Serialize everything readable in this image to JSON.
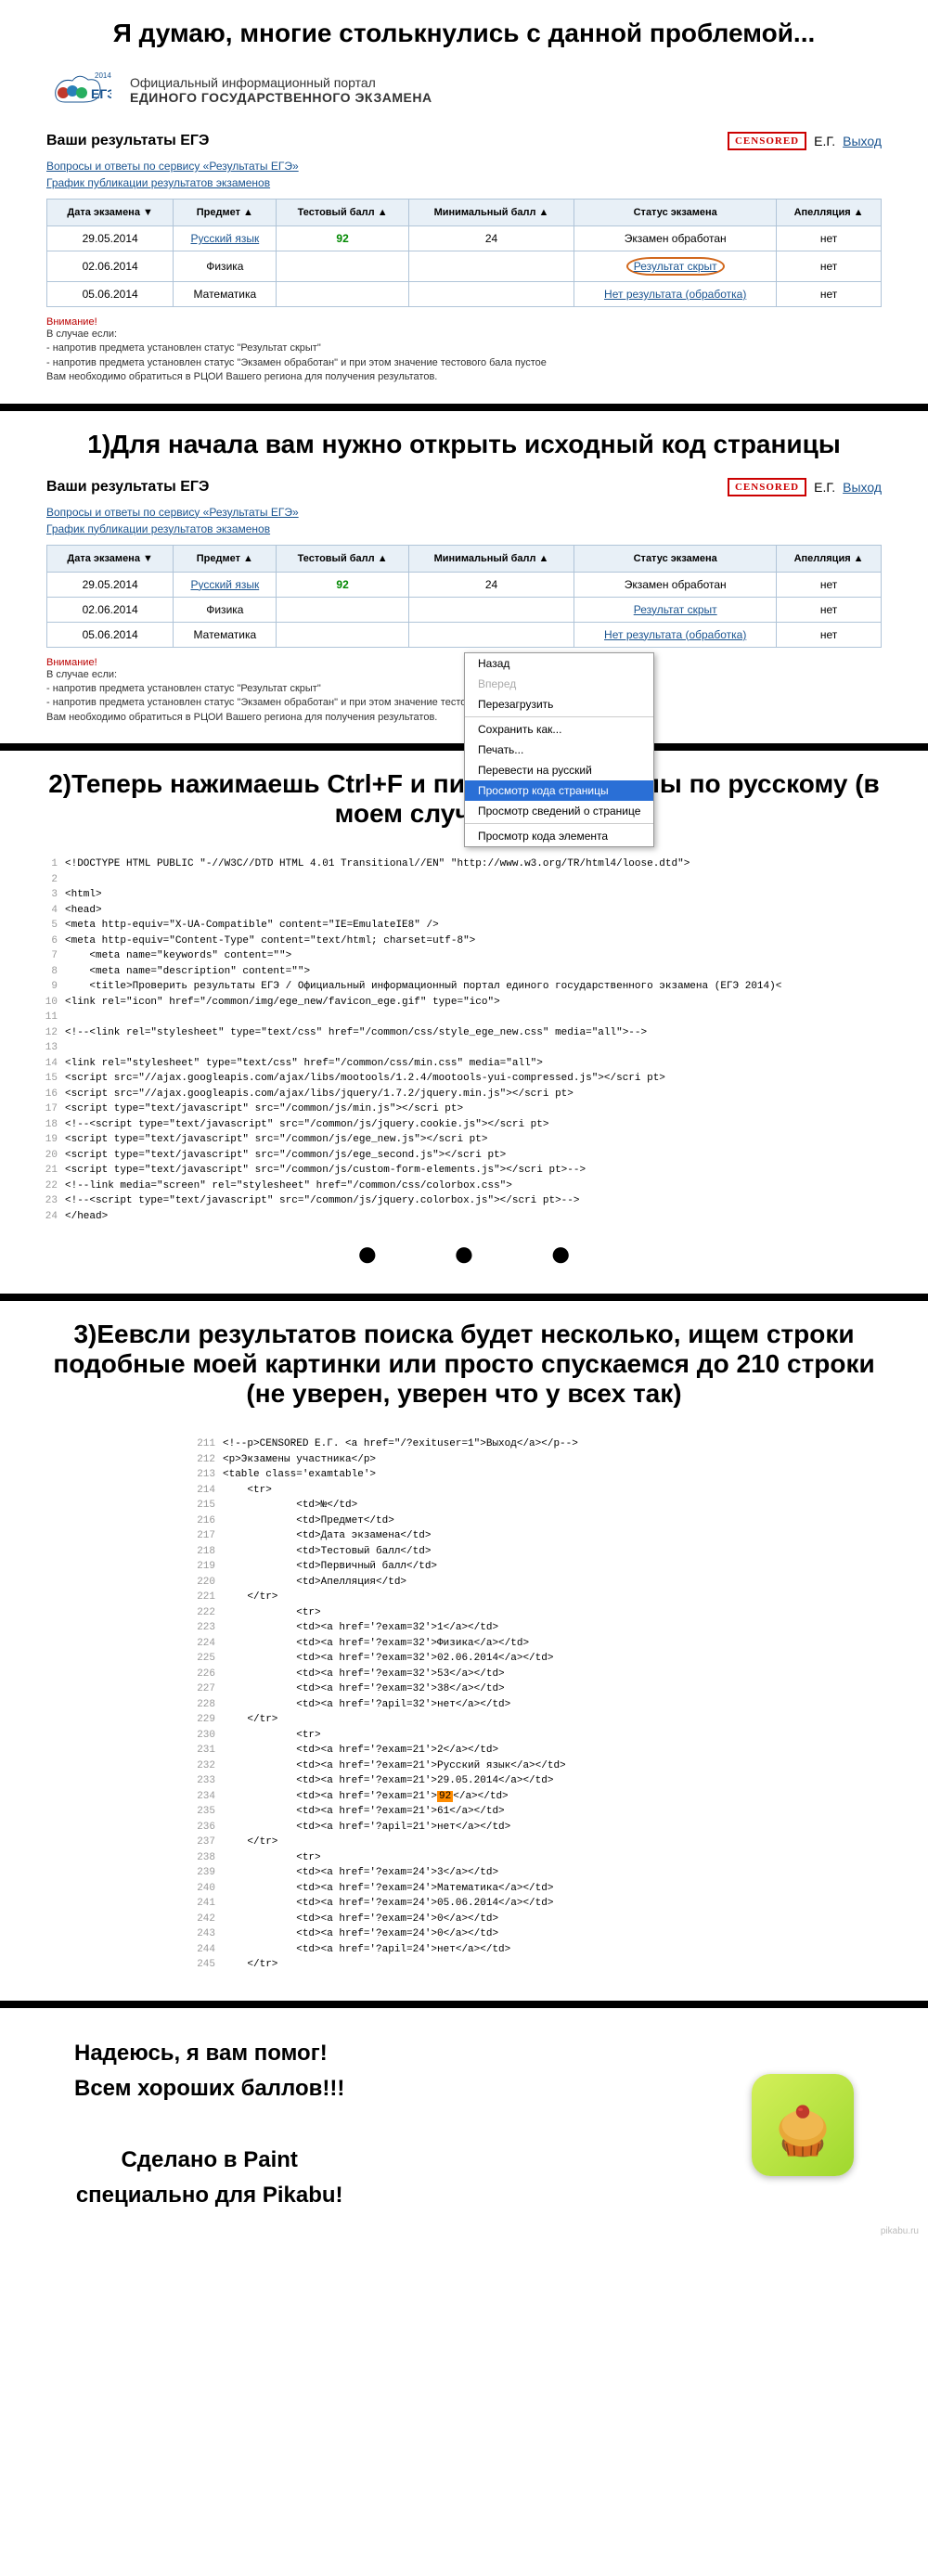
{
  "intro_title": "Я думаю, многие столькнулись с данной проблемой...",
  "portal": {
    "year": "2014",
    "logo_text": "ЕГЭ",
    "line1": "Официальный информационный портал",
    "line2": "ЕДИНОГО ГОСУДАРСТВЕННОГО ЭКЗАМЕНА"
  },
  "results_header": "Ваши результаты ЕГЭ",
  "censored": "CENSORED",
  "user_initials": "Е.Г.",
  "logout": "Выход",
  "qa_link": "Вопросы и ответы по сервису «Результаты ЕГЭ»",
  "schedule_link": "График публикации результатов экзаменов",
  "table_headers": {
    "date": "Дата экзамена ▼",
    "subject": "Предмет ▲",
    "test_score": "Тестовый балл ▲",
    "min_score": "Минимальный балл ▲",
    "status": "Статус экзамена",
    "appeal": "Апелляция ▲"
  },
  "rows1": [
    {
      "date": "29.05.2014",
      "subject": "Русский язык",
      "test": "92",
      "min": "24",
      "status": "Экзамен обработан",
      "appeal": "нет"
    },
    {
      "date": "02.06.2014",
      "subject": "Физика",
      "test": "",
      "min": "",
      "status": "Результат скрыт",
      "appeal": "нет",
      "circled": true
    },
    {
      "date": "05.06.2014",
      "subject": "Математика",
      "test": "",
      "min": "",
      "status": "Нет результата (обработка)",
      "appeal": "нет"
    }
  ],
  "warning_label": "Внимание!",
  "warning_body": "В случае если:\n- напротив предмета установлен статус \"Результат скрыт\"\n- напротив предмета установлен статус \"Экзамен обработан\" и при этом значение тестового бала пустое\nВам необходимо обратиться в РЦОИ Вашего региона для получения результатов.",
  "step1_title": "1)Для начала вам нужно открыть исходный код страницы",
  "context_menu": {
    "back": "Назад",
    "forward": "Вперед",
    "reload": "Перезагрузить",
    "save_as": "Сохранить как...",
    "print": "Печать...",
    "translate": "Перевести на русский",
    "view_source": "Просмотр кода страницы",
    "page_info": "Просмотр  сведений о странице",
    "inspect": "Просмотр кода элемента"
  },
  "step2_title": "2)Теперь нажимаешь Ctrl+F и пишем свои баллы по русскому (в моем случае это 92)",
  "code1": [
    {
      "n": 1,
      "t": "<!DOCTYPE HTML PUBLIC \"-//W3C//DTD HTML 4.01 Transitional//EN\" \"http://www.w3.org/TR/html4/loose.dtd\">"
    },
    {
      "n": 2,
      "t": ""
    },
    {
      "n": 3,
      "t": "<html>"
    },
    {
      "n": 4,
      "t": "<head>"
    },
    {
      "n": 5,
      "t": "<meta http-equiv=\"X-UA-Compatible\" content=\"IE=EmulateIE8\" />"
    },
    {
      "n": 6,
      "t": "<meta http-equiv=\"Content-Type\" content=\"text/html; charset=utf-8\">"
    },
    {
      "n": 7,
      "t": "    <meta name=\"keywords\" content=\"\">"
    },
    {
      "n": 8,
      "t": "    <meta name=\"description\" content=\"\">"
    },
    {
      "n": 9,
      "t": "    <title>Проверить результаты ЕГЭ / Официальный информационный портал единого государственного экзамена (ЕГЭ 2014)<"
    },
    {
      "n": 10,
      "t": "<link rel=\"icon\" href=\"/common/img/ege_new/favicon_ege.gif\" type=\"ico\">"
    },
    {
      "n": 11,
      "t": ""
    },
    {
      "n": 12,
      "t": "<!--<link rel=\"stylesheet\" type=\"text/css\" href=\"/common/css/style_ege_new.css\" media=\"all\">-->"
    },
    {
      "n": 13,
      "t": ""
    },
    {
      "n": 14,
      "t": "<link rel=\"stylesheet\" type=\"text/css\" href=\"/common/css/min.css\" media=\"all\">"
    },
    {
      "n": 15,
      "t": "<script src=\"//ajax.googleapis.com/ajax/libs/mootools/1.2.4/mootools-yui-compressed.js\"></scri pt>"
    },
    {
      "n": 16,
      "t": "<script src=\"//ajax.googleapis.com/ajax/libs/jquery/1.7.2/jquery.min.js\"></scri pt>"
    },
    {
      "n": 17,
      "t": "<script type=\"text/javascript\" src=\"/common/js/min.js\"></scri pt>"
    },
    {
      "n": 18,
      "t": "<!--<script type=\"text/javascript\" src=\"/common/js/jquery.cookie.js\"></scri pt>"
    },
    {
      "n": 19,
      "t": "<script type=\"text/javascript\" src=\"/common/js/ege_new.js\"></scri pt>"
    },
    {
      "n": 20,
      "t": "<script type=\"text/javascript\" src=\"/common/js/ege_second.js\"></scri pt>"
    },
    {
      "n": 21,
      "t": "<script type=\"text/javascript\" src=\"/common/js/custom-form-elements.js\"></scri pt>-->"
    },
    {
      "n": 22,
      "t": "<!--link media=\"screen\" rel=\"stylesheet\" href=\"/common/css/colorbox.css\">"
    },
    {
      "n": 23,
      "t": "<!--<script type=\"text/javascript\" src=\"/common/js/jquery.colorbox.js\"></scri pt>-->"
    },
    {
      "n": 24,
      "t": "</head>"
    }
  ],
  "dots": "● ● ●",
  "step3_title": "3)Еевсли результатов поиска будет несколько, ищем строки подобные моей картинки или просто спускаемся до 210 строки (не уверен, уверен что у всех так)",
  "code2": [
    {
      "n": 211,
      "t": "<!--p>CENSORED Е.Г. <a href=\"/?exituser=1\">Выход</a></p-->"
    },
    {
      "n": 212,
      "t": "<p>Экзамены участника</p>"
    },
    {
      "n": 213,
      "t": "<table class='examtable'>"
    },
    {
      "n": 214,
      "t": "    <tr>"
    },
    {
      "n": 215,
      "t": "            <td>№</td>"
    },
    {
      "n": 216,
      "t": "            <td>Предмет</td>"
    },
    {
      "n": 217,
      "t": "            <td>Дата экзамена</td>"
    },
    {
      "n": 218,
      "t": "            <td>Тестовый балл</td>"
    },
    {
      "n": 219,
      "t": "            <td>Первичный балл</td>"
    },
    {
      "n": 220,
      "t": "            <td>Апелляция</td>"
    },
    {
      "n": 221,
      "t": "    </tr>"
    },
    {
      "n": 222,
      "t": "            <tr>"
    },
    {
      "n": 223,
      "t": "            <td><a href='?exam=32'>1</a></td>"
    },
    {
      "n": 224,
      "t": "            <td><a href='?exam=32'>Физика</a></td>"
    },
    {
      "n": 225,
      "t": "            <td><a href='?exam=32'>02.06.2014</a></td>"
    },
    {
      "n": 226,
      "t": "            <td><a href='?exam=32'>53</a></td>"
    },
    {
      "n": 227,
      "t": "            <td><a href='?exam=32'>38</a></td>"
    },
    {
      "n": 228,
      "t": "            <td><a href='?apil=32'>нет</a></td>"
    },
    {
      "n": 229,
      "t": "    </tr>"
    },
    {
      "n": 230,
      "t": "            <tr>"
    },
    {
      "n": 231,
      "t": "            <td><a href='?exam=21'>2</a></td>"
    },
    {
      "n": 232,
      "t": "            <td><a href='?exam=21'>Русский язык</a></td>"
    },
    {
      "n": 233,
      "t": "            <td><a href='?exam=21'>29.05.2014</a></td>"
    },
    {
      "n": 234,
      "t": "            <td><a href='?exam=21'>",
      "hl": "92",
      "tail": "</a></td>"
    },
    {
      "n": 235,
      "t": "            <td><a href='?exam=21'>61</a></td>"
    },
    {
      "n": 236,
      "t": "            <td><a href='?apil=21'>нет</a></td>"
    },
    {
      "n": 237,
      "t": "    </tr>"
    },
    {
      "n": 238,
      "t": "            <tr>"
    },
    {
      "n": 239,
      "t": "            <td><a href='?exam=24'>3</a></td>"
    },
    {
      "n": 240,
      "t": "            <td><a href='?exam=24'>Математика</a></td>"
    },
    {
      "n": 241,
      "t": "            <td><a href='?exam=24'>05.06.2014</a></td>"
    },
    {
      "n": 242,
      "t": "            <td><a href='?exam=24'>0</a></td>"
    },
    {
      "n": 243,
      "t": "            <td><a href='?exam=24'>0</a></td>"
    },
    {
      "n": 244,
      "t": "            <td><a href='?apil=24'>нет</a></td>"
    },
    {
      "n": 245,
      "t": "    </tr>"
    }
  ],
  "footer": {
    "line1": "Надеюсь, я вам помог!",
    "line2": "Всем хороших баллов!!!",
    "line3": "Сделано в Paint",
    "line4": "специально для Pikabu!"
  },
  "watermark": "pikabu.ru"
}
